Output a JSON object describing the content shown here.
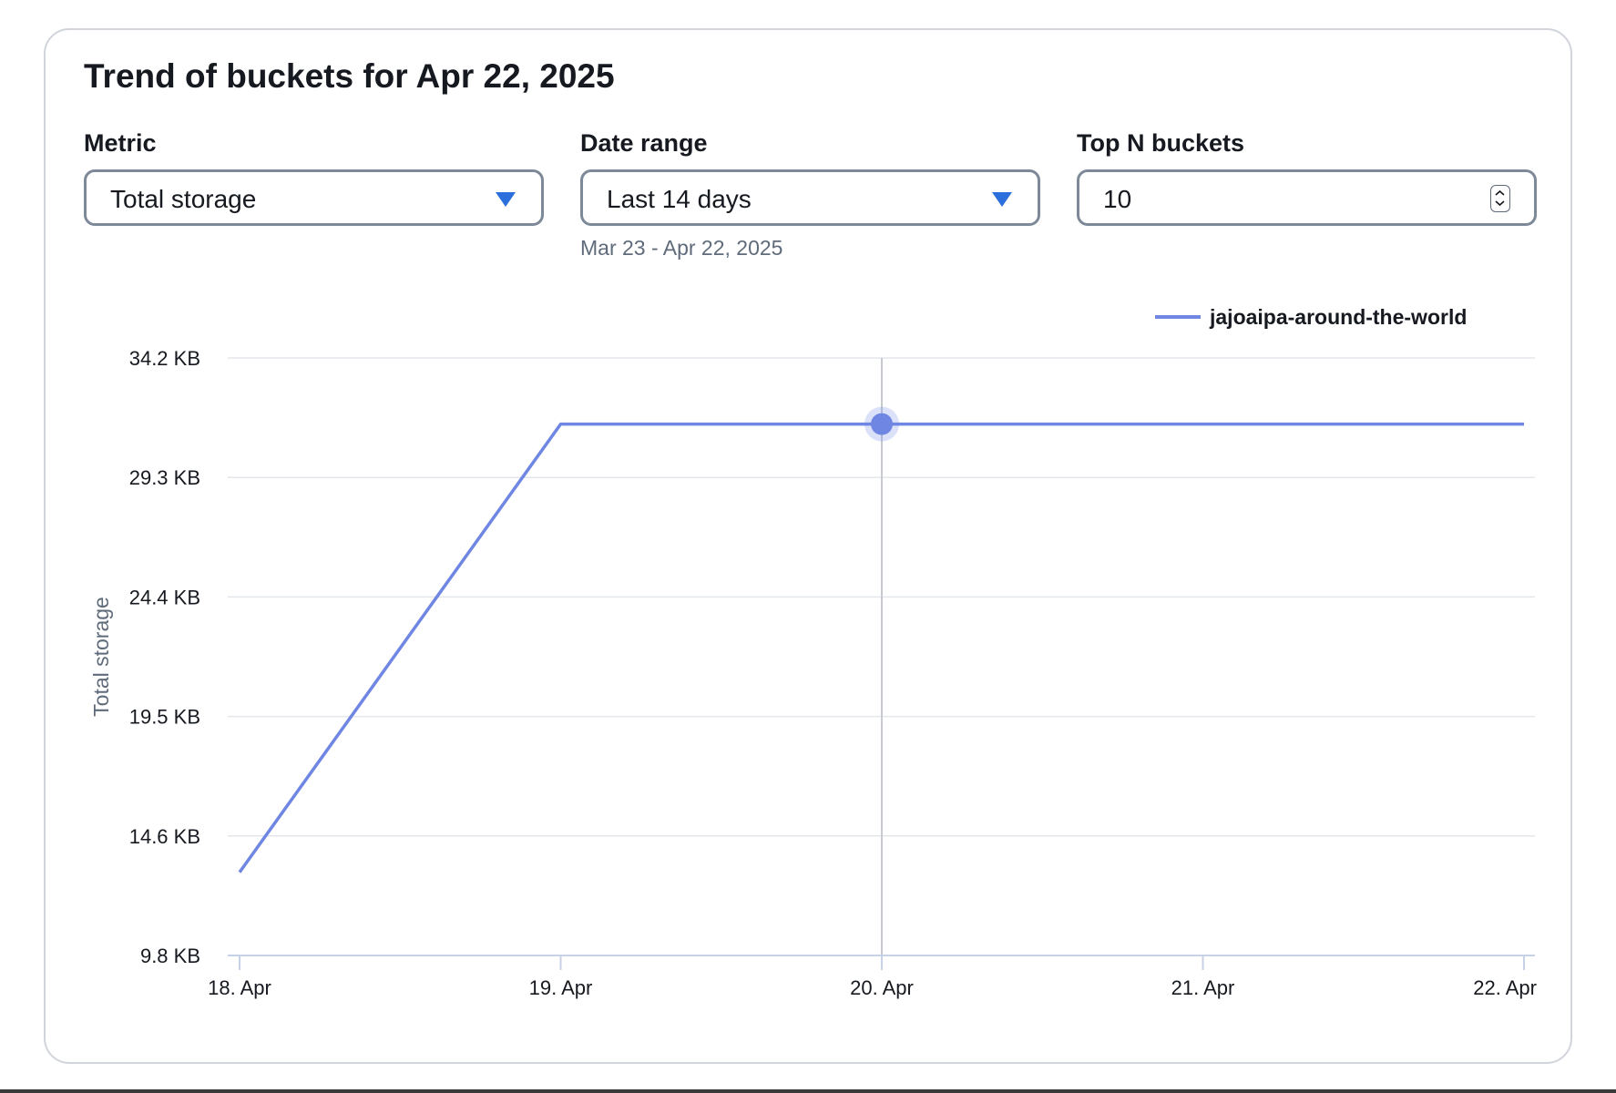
{
  "panel": {
    "title": "Trend of buckets for Apr 22, 2025"
  },
  "filters": {
    "metric": {
      "label": "Metric",
      "value": "Total storage",
      "icon": "caret-down-icon"
    },
    "date_range": {
      "label": "Date range",
      "value": "Last 14 days",
      "hint": "Mar 23 - Apr 22, 2025",
      "icon": "caret-down-icon"
    },
    "top_n": {
      "label": "Top N buckets",
      "value": "10",
      "icon": "stepper-icon"
    }
  },
  "colors": {
    "series": "#6f86e3",
    "caret": "#2a6fdb",
    "grid": "#e3e6ea",
    "crosshair": "#c6cad0"
  },
  "chart_data": {
    "type": "line",
    "title": "",
    "xlabel": "",
    "ylabel": "Total storage",
    "x": [
      "18. Apr",
      "19. Apr",
      "20. Apr",
      "21. Apr",
      "22. Apr"
    ],
    "y_ticks": [
      "9.8 KB",
      "14.6 KB",
      "19.5 KB",
      "24.4 KB",
      "29.3 KB",
      "34.2 KB"
    ],
    "ylim": [
      9.8,
      34.2
    ],
    "y_unit": "KB",
    "grid": true,
    "legend_position": "top-right",
    "highlighted_x": "20. Apr",
    "series": [
      {
        "name": "jajoaipa-around-the-world",
        "points": [
          {
            "x": "18. Apr",
            "y": 13.2
          },
          {
            "x": "19. Apr",
            "y": 31.5
          },
          {
            "x": "20. Apr",
            "y": 31.5
          },
          {
            "x": "21. Apr",
            "y": 31.5
          },
          {
            "x": "22. Apr",
            "y": 31.5
          }
        ]
      }
    ]
  }
}
